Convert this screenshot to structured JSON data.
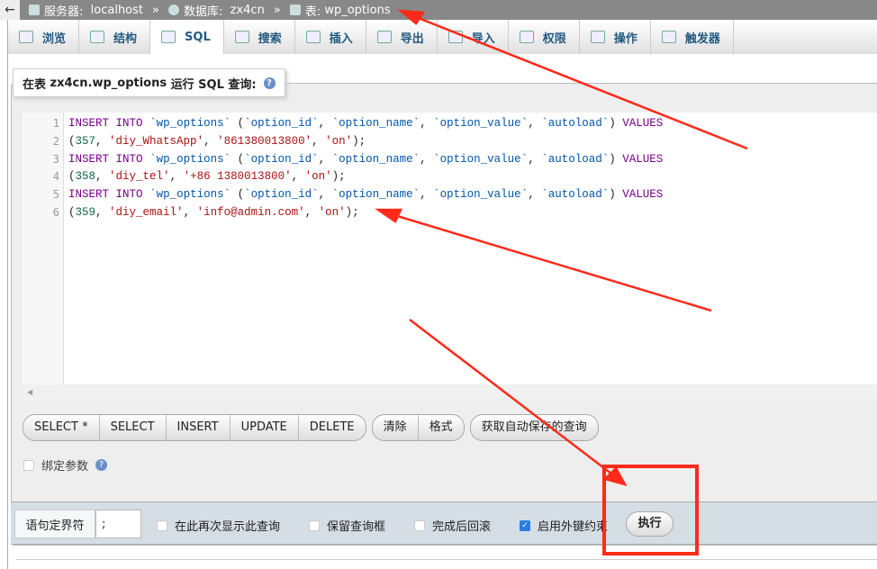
{
  "breadcrumb": {
    "back": "←",
    "server_label": "服务器:",
    "server": "localhost",
    "db_label": "数据库:",
    "db": "zx4cn",
    "table_label": "表:",
    "table": "wp_options",
    "sep": "»"
  },
  "tabs": [
    {
      "label": "浏览",
      "icon": "browse-icon"
    },
    {
      "label": "结构",
      "icon": "structure-icon"
    },
    {
      "label": "SQL",
      "icon": "sql-icon",
      "active": true
    },
    {
      "label": "搜索",
      "icon": "search-icon"
    },
    {
      "label": "插入",
      "icon": "insert-icon"
    },
    {
      "label": "导出",
      "icon": "export-icon"
    },
    {
      "label": "导入",
      "icon": "import-icon"
    },
    {
      "label": "权限",
      "icon": "privileges-icon"
    },
    {
      "label": "操作",
      "icon": "wrench-icon"
    },
    {
      "label": "触发器",
      "icon": "triggers-icon"
    }
  ],
  "legend": {
    "prefix": "在表",
    "table": "zx4cn.wp_options",
    "suffix": "运行 SQL 查询:"
  },
  "editor": {
    "lines": [
      "INSERT INTO `wp_options` (`option_id`, `option_name`, `option_value`, `autoload`) VALUES",
      "(357, 'diy_WhatsApp', '861380013800', 'on');",
      "INSERT INTO `wp_options` (`option_id`, `option_name`, `option_value`, `autoload`) VALUES",
      "(358, 'diy_tel', '+86 1380013800', 'on');",
      "INSERT INTO `wp_options` (`option_id`, `option_name`, `option_value`, `autoload`) VALUES",
      "(359, 'diy_email', 'info@admin.com', 'on');"
    ],
    "line_numbers": [
      "1",
      "2",
      "3",
      "4",
      "5",
      "6"
    ]
  },
  "buttons": {
    "group1": [
      "SELECT *",
      "SELECT",
      "INSERT",
      "UPDATE",
      "DELETE"
    ],
    "group2": [
      "清除",
      "格式"
    ],
    "autosave": "获取自动保存的查询"
  },
  "bind_params": {
    "label": "绑定参数",
    "checked": false
  },
  "footer": {
    "delimiter_label": "语句定界符",
    "delimiter_value": ";",
    "options": [
      {
        "label": "在此再次显示此查询",
        "checked": false
      },
      {
        "label": "保留查询框",
        "checked": false
      },
      {
        "label": "完成后回滚",
        "checked": false
      },
      {
        "label": "启用外键约束",
        "checked": true
      }
    ],
    "go": "执行"
  },
  "colors": {
    "annotation": "#ff2a1a",
    "keyword": "#770088",
    "identifier": "#0055aa",
    "string": "#aa1111",
    "number": "#116644"
  }
}
